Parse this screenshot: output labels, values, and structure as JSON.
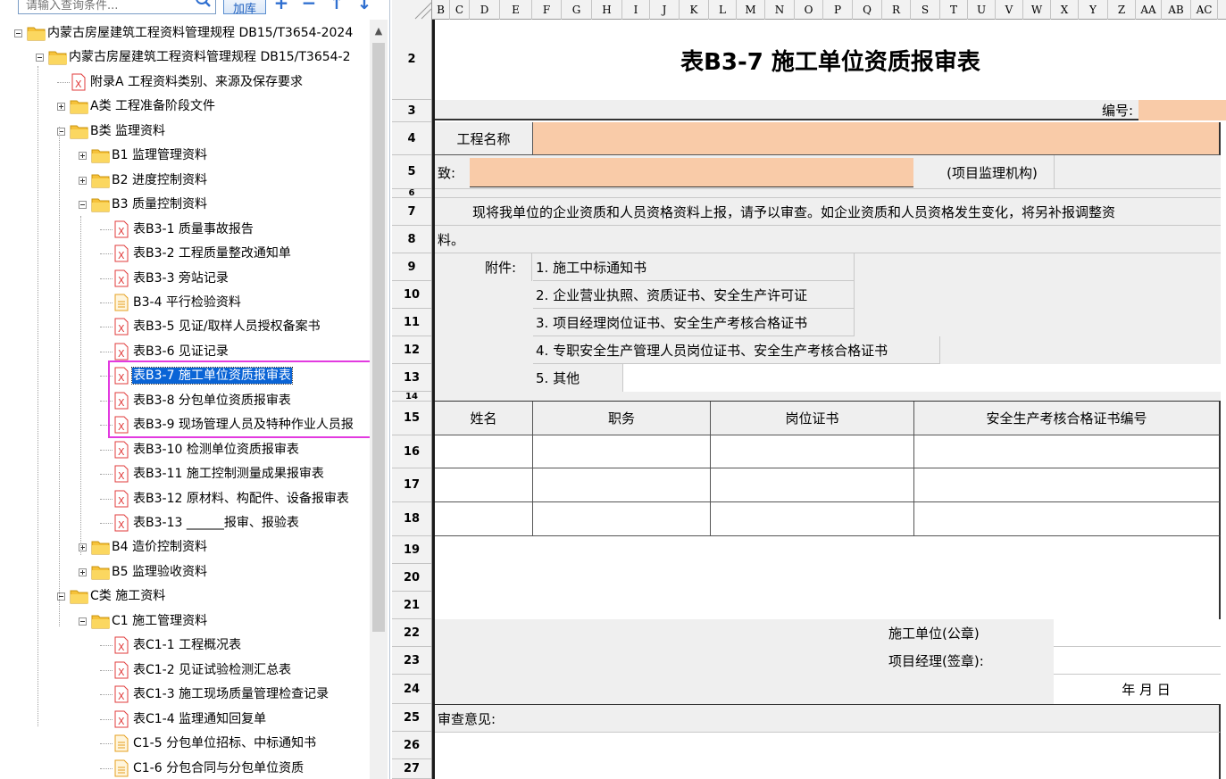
{
  "toolbar": {
    "search_placeholder": "请输入查询条件...",
    "add_lib_label": "加库",
    "add_label": "+",
    "remove_label": "−",
    "up_label": "↑",
    "down_label": "↓"
  },
  "tree": {
    "items": [
      {
        "label": "内蒙古房屋建筑工程资料管理规程 DB15/T3654-2024",
        "type": "folder"
      },
      {
        "label": "内蒙古房屋建筑工程资料管理规程 DB15/T3654-2",
        "type": "folder"
      },
      {
        "label": "附录A  工程资料类别、来源及保存要求",
        "type": "doc-x"
      },
      {
        "label": "A类 工程准备阶段文件",
        "type": "folder"
      },
      {
        "label": "B类 监理资料",
        "type": "folder"
      },
      {
        "label": "B1 监理管理资料",
        "type": "folder"
      },
      {
        "label": "B2 进度控制资料",
        "type": "folder"
      },
      {
        "label": "B3 质量控制资料",
        "type": "folder"
      },
      {
        "label": "表B3-1 质量事故报告",
        "type": "doc-x"
      },
      {
        "label": "表B3-2 工程质量整改通知单",
        "type": "doc-x"
      },
      {
        "label": "表B3-3 旁站记录",
        "type": "doc-x"
      },
      {
        "label": "B3-4 平行检验资料",
        "type": "doc-t"
      },
      {
        "label": "表B3-5 见证/取样人员授权备案书",
        "type": "doc-x"
      },
      {
        "label": "表B3-6 见证记录",
        "type": "doc-x"
      },
      {
        "label": "表B3-7 施工单位资质报审表",
        "type": "doc-x",
        "selected": true
      },
      {
        "label": "表B3-8 分包单位资质报审表",
        "type": "doc-x"
      },
      {
        "label": "表B3-9 现场管理人员及特种作业人员报",
        "type": "doc-x"
      },
      {
        "label": "表B3-10 检测单位资质报审表",
        "type": "doc-x"
      },
      {
        "label": "表B3-11 施工控制测量成果报审表",
        "type": "doc-x"
      },
      {
        "label": "表B3-12 原材料、构配件、设备报审表",
        "type": "doc-x"
      },
      {
        "label": "表B3-13 ______报审、报验表",
        "type": "doc-x"
      },
      {
        "label": "B4 造价控制资料",
        "type": "folder"
      },
      {
        "label": "B5 监理验收资料",
        "type": "folder"
      },
      {
        "label": "C类 施工资料",
        "type": "folder"
      },
      {
        "label": "C1 施工管理资料",
        "type": "folder"
      },
      {
        "label": "表C1-1 工程概况表",
        "type": "doc-x"
      },
      {
        "label": "表C1-2 见证试验检测汇总表",
        "type": "doc-x"
      },
      {
        "label": "表C1-3 施工现场质量管理检查记录",
        "type": "doc-x"
      },
      {
        "label": "表C1-4 监理通知回复单",
        "type": "doc-x"
      },
      {
        "label": "C1-5 分包单位招标、中标通知书",
        "type": "doc-t"
      },
      {
        "label": "C1-6 分包合同与分包单位资质",
        "type": "doc-t"
      }
    ]
  },
  "sheet": {
    "columns": [
      "B",
      "C",
      "D",
      "E",
      "F",
      "G",
      "H",
      "I",
      "J",
      "K",
      "L",
      "M",
      "N",
      "O",
      "P",
      "Q",
      "R",
      "S",
      "T",
      "U",
      "V",
      "W",
      "X",
      "Y",
      "Z",
      "AA",
      "AB",
      "AC"
    ],
    "rows": [
      "2",
      "3",
      "4",
      "5",
      "6",
      "7",
      "8",
      "9",
      "10",
      "11",
      "12",
      "13",
      "14",
      "15",
      "16",
      "17",
      "18",
      "19",
      "20",
      "21",
      "22",
      "23",
      "24",
      "25",
      "26",
      "27"
    ],
    "title": "表B3-7 施工单位资质报审表",
    "code_label": "编号:",
    "project_name_label": "工程名称",
    "to_label": "致:",
    "supervisor_org": "(项目监理机构)",
    "body_line1": "现将我单位的企业资质和人员资格资料上报，请予以审查。如企业资质和人员资格发生变化，将另补报调整资",
    "body_line2": "料。",
    "attach_label": "附件:",
    "attachments": [
      "1. 施工中标通知书",
      "2. 企业营业执照、资质证书、安全生产许可证",
      "3. 项目经理岗位证书、安全生产考核合格证书",
      "4. 专职安全生产管理人员岗位证书、安全生产考核合格证书",
      "5. 其他"
    ],
    "table_headers": [
      "姓名",
      "职务",
      "岗位证书",
      "安全生产考核合格证书编号"
    ],
    "unit_label": "施工单位(公章)",
    "pm_label": "项目经理(签章):",
    "date_label": "年   月   日",
    "review_label": "审查意见:"
  },
  "colors": {
    "selection": "#0a64d6",
    "highlight_box": "#e23ae0",
    "input_fill": "#f9cba8",
    "folder": "#f6c23a",
    "doc_red": "#e03b3b"
  }
}
